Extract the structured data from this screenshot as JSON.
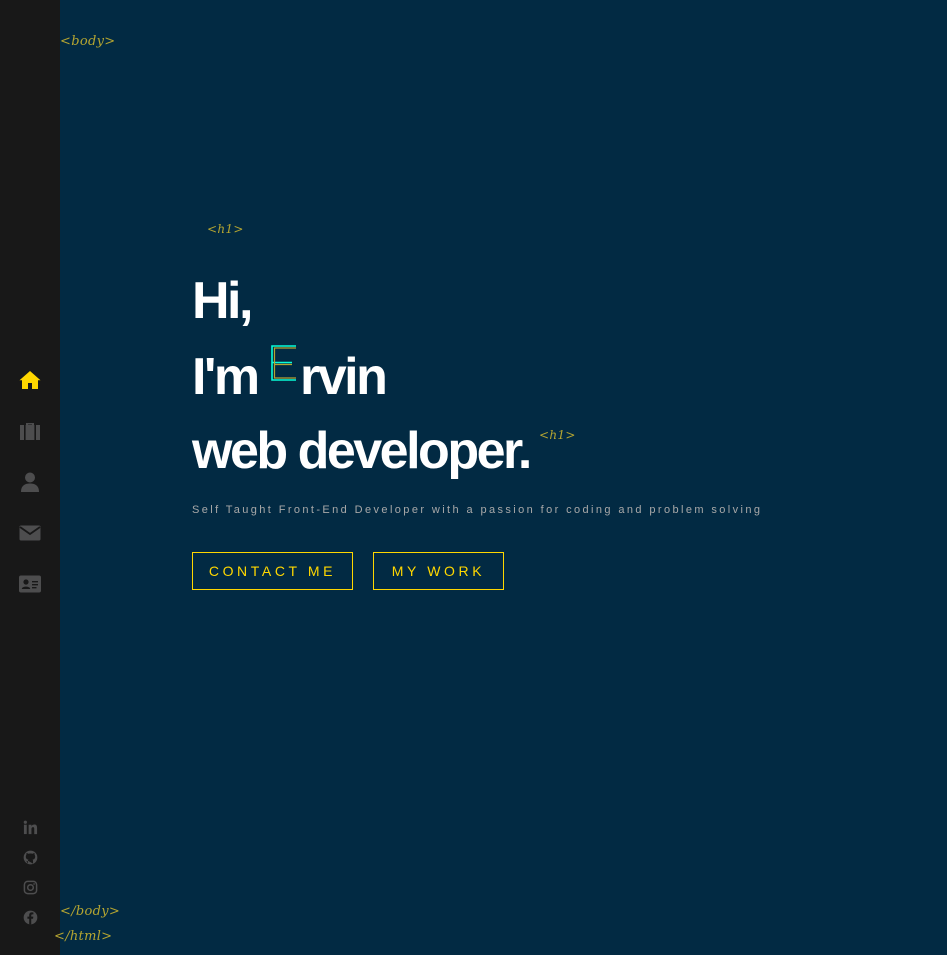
{
  "tags": {
    "body_open": "<body>",
    "h1_open": "<h1>",
    "h1_close": "<h1>",
    "body_close": "</body>",
    "html_close": "</html>"
  },
  "hero": {
    "line1": "Hi,",
    "line2_prefix": "I'm",
    "logo_letter": "E",
    "line2_suffix": "rvin",
    "line3": "web developer.",
    "subtitle": "Self Taught Front-End Developer with a passion for coding and problem solving"
  },
  "buttons": {
    "contact": "CONTACT ME",
    "work": "MY WORK"
  },
  "nav": {
    "items": [
      {
        "icon": "home-icon",
        "active": true
      },
      {
        "icon": "briefcase-icon",
        "active": false
      },
      {
        "icon": "user-icon",
        "active": false
      },
      {
        "icon": "envelope-icon",
        "active": false
      },
      {
        "icon": "id-card-icon",
        "active": false
      }
    ]
  },
  "social": [
    "linkedin-icon",
    "github-icon",
    "instagram-icon",
    "facebook-icon"
  ],
  "colors": {
    "background": "#022a43",
    "sidebar": "#181818",
    "accent": "#ffd700",
    "tag": "#b5a531",
    "icon_inactive": "#4d4d4e",
    "logo_stroke": "#08fdd8"
  }
}
